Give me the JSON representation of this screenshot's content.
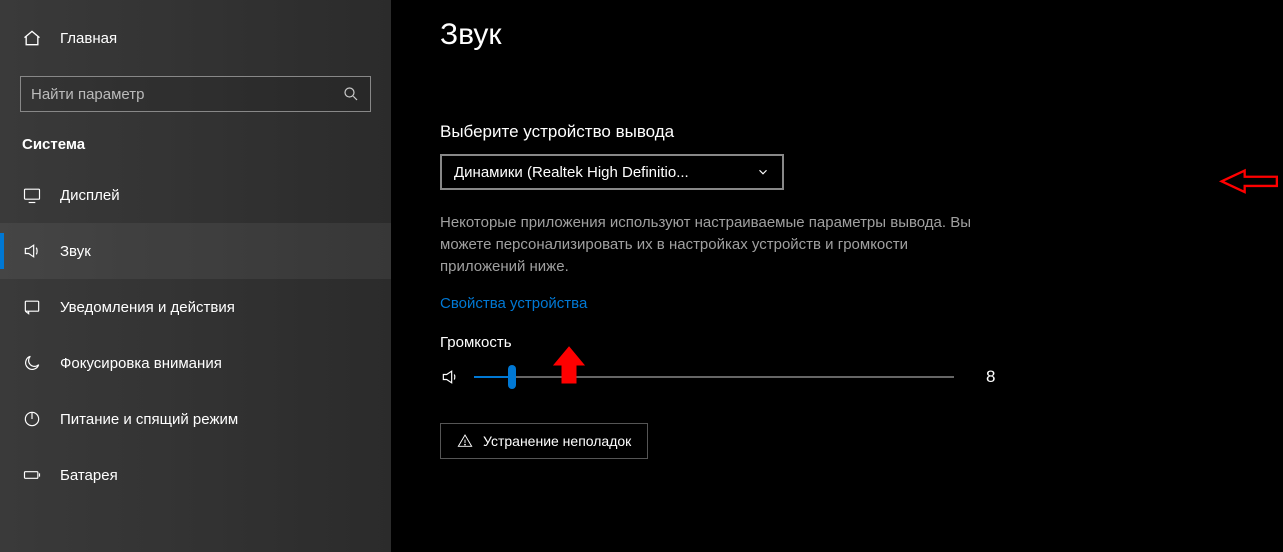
{
  "sidebar": {
    "home_label": "Главная",
    "search_placeholder": "Найти параметр",
    "category_label": "Система",
    "items": [
      {
        "label": "Дисплей"
      },
      {
        "label": "Звук"
      },
      {
        "label": "Уведомления и действия"
      },
      {
        "label": "Фокусировка внимания"
      },
      {
        "label": "Питание и спящий режим"
      },
      {
        "label": "Батарея"
      }
    ]
  },
  "main": {
    "page_title": "Звук",
    "output_heading": "Выберите устройство вывода",
    "output_device": "Динамики (Realtek High Definitio...",
    "output_description": "Некоторые приложения используют настраиваемые параметры вывода. Вы можете персонализировать их в настройках устройств и громкости приложений ниже.",
    "device_properties_link": "Свойства устройства",
    "volume_label": "Громкость",
    "volume_value": "8",
    "volume_percent": 8,
    "troubleshoot_label": "Устранение неполадок"
  }
}
